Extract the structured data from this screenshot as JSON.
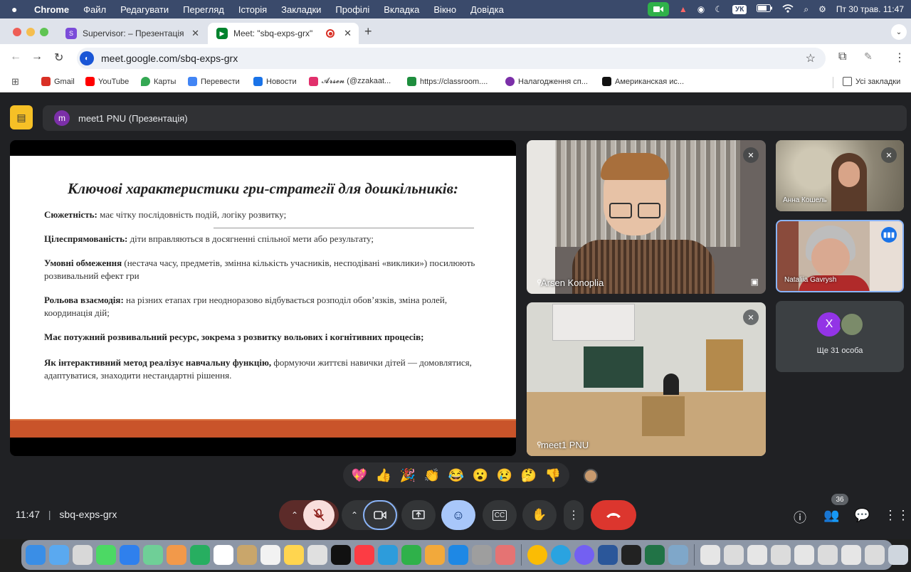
{
  "menubar": {
    "app": "Chrome",
    "items": [
      "Файл",
      "Редагувати",
      "Перегляд",
      "Історія",
      "Закладки",
      "Профілі",
      "Вкладка",
      "Вікно",
      "Довідка"
    ],
    "lang": "УК",
    "datetime": "Пт 30 трав.  11:47"
  },
  "tabs": [
    {
      "title": "Supervisor: – Презентація",
      "color": "#7b4cd9"
    },
    {
      "title": "Meet: \"sbq-exps-grx\"",
      "color": "#00832d"
    }
  ],
  "addressbar": {
    "url": "meet.google.com/sbq-exps-grx"
  },
  "bookmarks": {
    "items": [
      {
        "label": "Gmail",
        "color": "#d93025"
      },
      {
        "label": "YouTube",
        "color": "#ff0000"
      },
      {
        "label": "Карты",
        "color": "#34a853"
      },
      {
        "label": "Перевести",
        "color": "#4285f4"
      },
      {
        "label": "Новости",
        "color": "#1a73e8"
      },
      {
        "label": "𝓐𝓻𝓼𝓮𝓷 (@zzakaat...",
        "color": "#e1306c"
      },
      {
        "label": "https://classroom....",
        "color": "#1e8e3e"
      },
      {
        "label": "Налагодження сп...",
        "color": "#7b2fa8"
      },
      {
        "label": "Американская ис...",
        "color": "#111111"
      }
    ],
    "all_bookmarks": "Усі закладки"
  },
  "meet": {
    "presenter_avatar": "m",
    "presenter_label": "meet1 PNU (Презентація)",
    "slide": {
      "title": "Ключові характеристики гри-стратегії для дошкільників:",
      "lines": [
        {
          "bold": "Сюжетність:",
          "text": " має чітку послідовність подій, логіку розвитку;"
        },
        {
          "bold": "Цілеспрямованість:",
          "text": " діти вправляються в досягненні спільної мети або результату;"
        },
        {
          "bold": "Умовні обмеження",
          "text": " (нестача часу, предметів, змінна кількість учасників, несподівані «виклики») посилюють розвивальний ефект гри"
        },
        {
          "bold": "Рольова взаємодія:",
          "text": " на різних етапах гри неодноразово відбувається розподіл обов’язків, зміна ролей, координація дій;"
        },
        {
          "bold": "Має потужний розвивальний ресурс, зокрема з розвитку вольових і когнітивних процесів;",
          "text": ""
        },
        {
          "bold": "Як інтерактивний метод реалізує навчальну функцію,",
          "text": " формуючи життєві навички дітей — домовлятися, адаптуватися, знаходити нестандартні рішення."
        }
      ]
    },
    "participants": [
      {
        "name": "Arsen Konoplia"
      },
      {
        "name": "Анна Кошель"
      },
      {
        "name": "Nataliia Gavrysh"
      },
      {
        "name": "meet1 PNU"
      }
    ],
    "more": {
      "avatar": "X",
      "label": "Ще 31 особа"
    },
    "reactions": [
      "💖",
      "👍",
      "🎉",
      "👏",
      "😂",
      "😮",
      "😢",
      "🤔",
      "👎"
    ],
    "time": "11:47",
    "meeting_code": "sbq-exps-grx",
    "people_count": "36"
  }
}
